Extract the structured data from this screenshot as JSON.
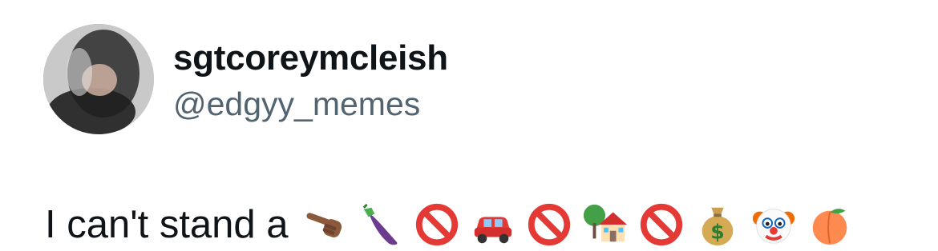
{
  "tweet": {
    "display_name": "sgtcoreymcleish",
    "handle": "@edgyy_memes",
    "text": "I can't stand a",
    "emojis": [
      "pointing-hand-icon",
      "eggplant-icon",
      "prohibited-icon",
      "red-car-icon",
      "prohibited-icon",
      "house-with-tree-icon",
      "prohibited-icon",
      "money-bag-icon",
      "clown-face-icon",
      "peach-icon"
    ]
  }
}
